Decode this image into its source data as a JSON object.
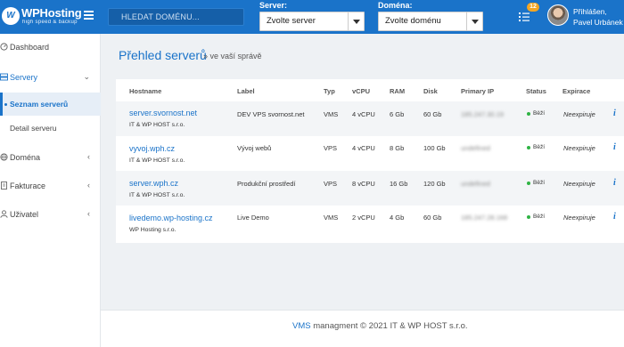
{
  "brand": {
    "name": "WPHosting",
    "tagline": "high speed & backup",
    "mark": "W"
  },
  "header": {
    "search_placeholder": "HLEDAT DOMÉNU...",
    "server_label": "Server:",
    "server_value": "Zvolte server",
    "domain_label": "Doména:",
    "domain_value": "Zvolte doménu",
    "notification_count": "12",
    "user_greeting": "Přihlášen,",
    "user_name": "Pavel Urbánek"
  },
  "sidebar": {
    "items": [
      {
        "label": "Dashboard",
        "icon": "dashboard-icon"
      },
      {
        "label": "Servery",
        "icon": "server-icon"
      },
      {
        "label": "Doména",
        "icon": "globe-icon"
      },
      {
        "label": "Fakturace",
        "icon": "document-icon"
      },
      {
        "label": "Uživatel",
        "icon": "user-icon"
      }
    ],
    "subitems": [
      {
        "label": "Seznam serverů"
      },
      {
        "label": "Detail serveru"
      }
    ]
  },
  "main": {
    "title": "Přehled serverů",
    "subtitle": "» ve vaší správě",
    "columns": [
      "Hostname",
      "Label",
      "Typ",
      "vCPU",
      "RAM",
      "Disk",
      "Primary IP",
      "Status",
      "Expirace"
    ],
    "rows": [
      {
        "hostname": "server.svornost.net",
        "owner": "IT & WP HOST s.r.o.",
        "label": "DEV VPS svornost.net",
        "type": "VMS",
        "vcpu": "4 vCPU",
        "ram": "6 Gb",
        "disk": "60 Gb",
        "ip": "185.247.30.19",
        "status": "Běží",
        "expiry": "Neexpiruje"
      },
      {
        "hostname": "vyvoj.wph.cz",
        "owner": "IT & WP HOST s.r.o.",
        "label": "Vývoj webů",
        "type": "VPS",
        "vcpu": "4 vCPU",
        "ram": "8 Gb",
        "disk": "100 Gb",
        "ip": "undefined",
        "status": "Běží",
        "expiry": "Neexpiruje"
      },
      {
        "hostname": "server.wph.cz",
        "owner": "IT & WP HOST s.r.o.",
        "label": "Produkční prostředí",
        "type": "VPS",
        "vcpu": "8 vCPU",
        "ram": "16 Gb",
        "disk": "120 Gb",
        "ip": "undefined",
        "status": "Běží",
        "expiry": "Neexpiruje"
      },
      {
        "hostname": "livedemo.wp-hosting.cz",
        "owner": "WP Hosting s.r.o.",
        "label": "Live Demo",
        "type": "VMS",
        "vcpu": "2 vCPU",
        "ram": "4 Gb",
        "disk": "60 Gb",
        "ip": "185.247.28.168",
        "status": "Běží",
        "expiry": "Neexpiruje"
      }
    ],
    "info_glyph": "i"
  },
  "footer": {
    "brand": "VMS",
    "text": "managment © 2021 IT & WP HOST s.r.o."
  },
  "colors": {
    "primary": "#1a73c9",
    "status_ok": "#2fb344",
    "badge": "#f5a623"
  }
}
